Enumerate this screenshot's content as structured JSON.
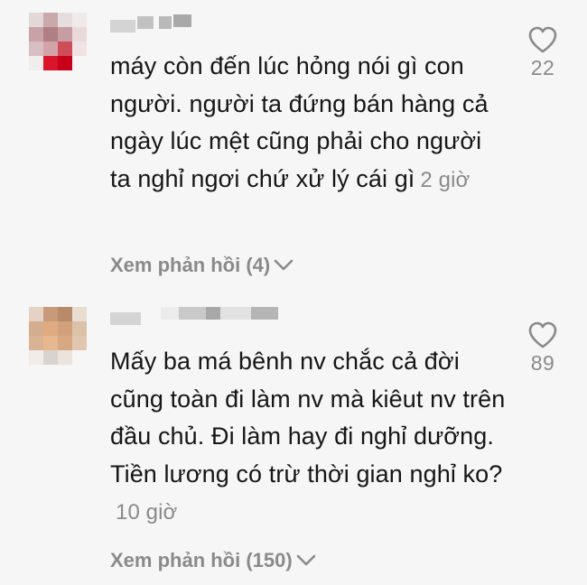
{
  "comments": [
    {
      "text": "máy còn đến lúc hỏng nói gì con người. người ta đứng bán hàng cả ngày lúc mệt cũng phải cho người ta nghỉ ngơi chứ xử lý cái gì",
      "time": "2 giờ",
      "likes": "22",
      "replies_label": "Xem phản hồi (4)"
    },
    {
      "text": "Mấy ba má bênh nv chắc cả đời cũng toàn đi làm nv mà kiêut nv trên đầu chủ. Đi làm hay đi nghỉ dưỡng. Tiền lương có trừ thời gian nghỉ ko?",
      "time": "10 giờ",
      "likes": "89",
      "replies_label": "Xem phản hồi (150)"
    }
  ],
  "colors": {
    "text": "#161616",
    "muted": "#8a8a8a",
    "background": "#f6f6f6"
  },
  "icons": {
    "like": "heart-outline-icon",
    "expand": "chevron-down-icon"
  }
}
